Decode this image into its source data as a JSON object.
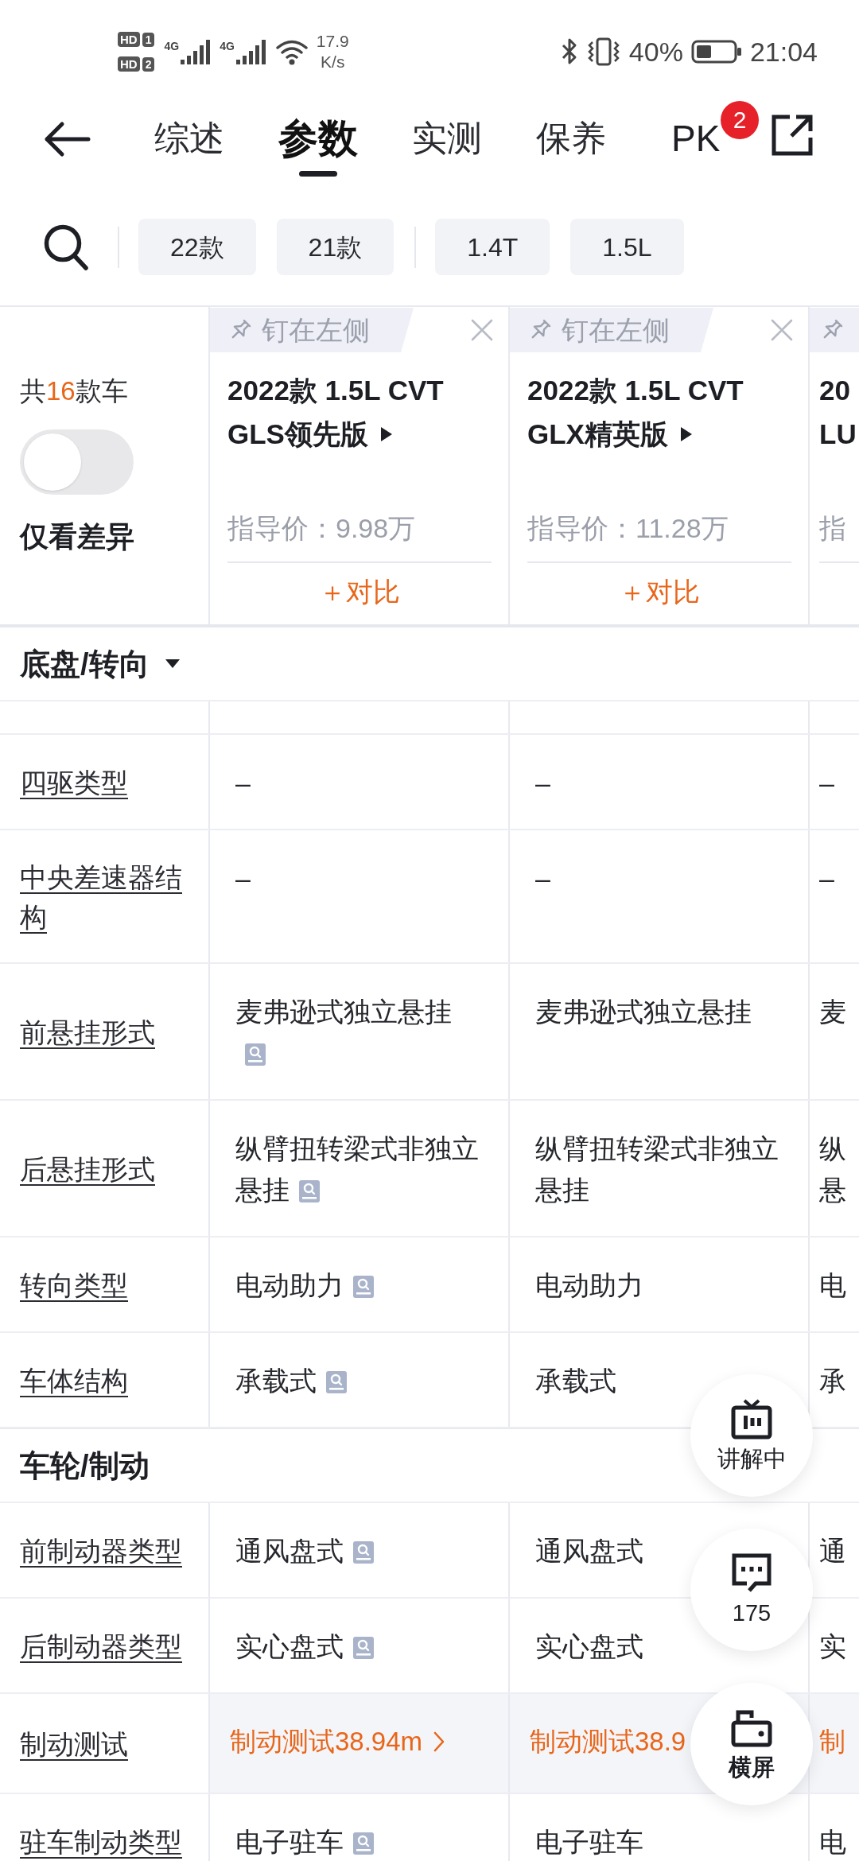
{
  "status_bar": {
    "sims": [
      {
        "label": "HD",
        "slot": "1"
      },
      {
        "label": "HD",
        "slot": "2"
      }
    ],
    "networks": [
      "4G",
      "4G"
    ],
    "speed": "17.9",
    "speed_unit": "K/s",
    "battery": "40%",
    "time": "21:04"
  },
  "nav": {
    "tabs": [
      {
        "label": "综述",
        "selected": false
      },
      {
        "label": "参数",
        "selected": true
      },
      {
        "label": "实测",
        "selected": false
      },
      {
        "label": "保养",
        "selected": false
      }
    ],
    "pk": {
      "label": "PK",
      "badge": "2"
    }
  },
  "filters": [
    {
      "chips": [
        "22款",
        "21款"
      ]
    },
    {
      "chips": [
        "1.4T",
        "1.5L"
      ]
    }
  ],
  "summary": {
    "count_prefix": "共",
    "count": "16",
    "count_suffix": "款车",
    "diff_only": false,
    "diff_label": "仅看差异"
  },
  "cars": [
    {
      "kind": "full",
      "pin_label": "钉在左侧",
      "title_lines": [
        "2022款 1.5L CVT",
        "GLS领先版"
      ],
      "price": "指导价：9.98万",
      "compare": "＋对比"
    },
    {
      "kind": "full",
      "pin_label": "钉在左侧",
      "title_lines": [
        "2022款 1.5L CVT",
        "GLX精英版"
      ],
      "price": "指导价：11.28万",
      "compare": "＋对比"
    },
    {
      "kind": "clipped",
      "title_lines": [
        "20",
        "LU"
      ],
      "price": "指"
    }
  ],
  "sections": [
    {
      "title": "底盘/转向",
      "dropdown": true,
      "partial_row_above": true,
      "rows": [
        {
          "kind": "spec",
          "label": "四驱类型",
          "cells": [
            {
              "text": "–",
              "info": false
            },
            {
              "text": "–",
              "info": false
            },
            {
              "text": "–",
              "info": false
            }
          ]
        },
        {
          "kind": "spec",
          "label": "中央差速器结构",
          "cells": [
            {
              "text": "–",
              "info": false
            },
            {
              "text": "–",
              "info": false
            },
            {
              "text": "–",
              "info": false
            }
          ]
        },
        {
          "kind": "spec",
          "label": "前悬挂形式",
          "cells": [
            {
              "text": "麦弗逊式独立悬挂",
              "info": true
            },
            {
              "text": "麦弗逊式独立悬挂",
              "info": false
            },
            {
              "text": "麦",
              "info": false
            }
          ]
        },
        {
          "kind": "spec",
          "label": "后悬挂形式",
          "cells": [
            {
              "lines": [
                "纵臂扭转梁式非独立",
                "悬挂"
              ],
              "info": true
            },
            {
              "lines": [
                "纵臂扭转梁式非独立",
                "悬挂"
              ],
              "info": false
            },
            {
              "lines": [
                "纵",
                "悬"
              ],
              "info": false
            }
          ]
        },
        {
          "kind": "spec",
          "label": "转向类型",
          "cells": [
            {
              "text": "电动助力",
              "info": true
            },
            {
              "text": "电动助力",
              "info": false
            },
            {
              "text": "电",
              "info": false
            }
          ]
        },
        {
          "kind": "spec",
          "label": "车体结构",
          "cells": [
            {
              "text": "承载式",
              "info": true
            },
            {
              "text": "承载式",
              "info": false
            },
            {
              "text": "承",
              "info": false
            }
          ]
        }
      ]
    },
    {
      "title": "车轮/制动",
      "dropdown": false,
      "partial_row_above": false,
      "rows": [
        {
          "kind": "spec",
          "label": "前制动器类型",
          "cells": [
            {
              "text": "通风盘式",
              "info": true
            },
            {
              "text": "通风盘式",
              "info": false
            },
            {
              "text": "通",
              "info": false
            }
          ]
        },
        {
          "kind": "spec",
          "label": "后制动器类型",
          "cells": [
            {
              "text": "实心盘式",
              "info": true
            },
            {
              "text": "实心盘式",
              "info": false
            },
            {
              "text": "实",
              "info": false
            }
          ]
        },
        {
          "kind": "test",
          "label": "制动测试",
          "cells": [
            {
              "text": "制动测试38.94m",
              "chevron": true
            },
            {
              "text": "制动测试38.9",
              "chevron": false
            },
            {
              "text": "制",
              "chevron": false
            }
          ]
        },
        {
          "kind": "spec",
          "label": "驻车制动类型",
          "cells": [
            {
              "text": "电子驻车",
              "info": true
            },
            {
              "text": "电子驻车",
              "info": false
            },
            {
              "text": "电",
              "info": false
            }
          ]
        }
      ]
    }
  ],
  "floating_buttons": [
    {
      "kind": "live",
      "label": "讲解中"
    },
    {
      "kind": "comments",
      "label": "175"
    },
    {
      "kind": "landscape",
      "label": "横屏"
    }
  ]
}
